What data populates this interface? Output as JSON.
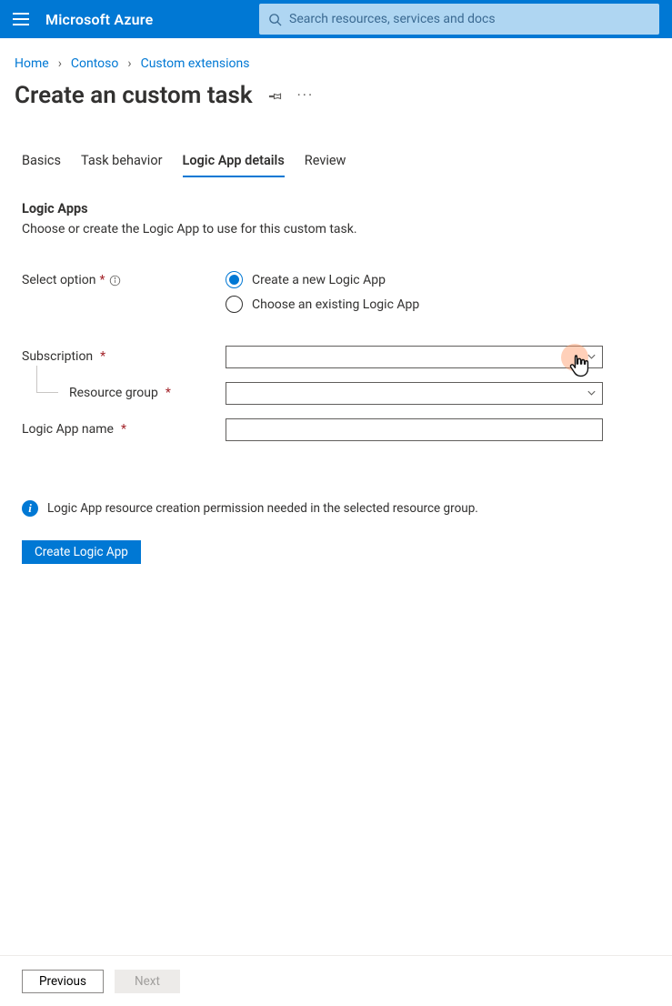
{
  "topbar": {
    "brand": "Microsoft Azure",
    "search_placeholder": "Search resources, services and docs"
  },
  "breadcrumb": {
    "items": [
      "Home",
      "Contoso",
      "Custom extensions"
    ]
  },
  "page": {
    "title": "Create an custom task"
  },
  "tabs": {
    "items": [
      "Basics",
      "Task behavior",
      "Logic App details",
      "Review"
    ],
    "active_index": 2
  },
  "section": {
    "heading": "Logic Apps",
    "description": "Choose or create the Logic App to use for this custom task."
  },
  "select_option": {
    "label": "Select option",
    "options": [
      "Create a new Logic App",
      "Choose an existing Logic App"
    ],
    "selected_index": 0
  },
  "fields": {
    "subscription_label": "Subscription",
    "subscription_value": "",
    "resource_group_label": "Resource group",
    "resource_group_value": "",
    "logic_app_name_label": "Logic App name",
    "logic_app_name_value": ""
  },
  "info": {
    "text": "Logic App resource creation permission needed in the selected resource group."
  },
  "buttons": {
    "create_logic_app": "Create Logic App",
    "previous": "Previous",
    "next": "Next"
  },
  "glyphs": {
    "star": "*",
    "chevron_right": "›"
  }
}
